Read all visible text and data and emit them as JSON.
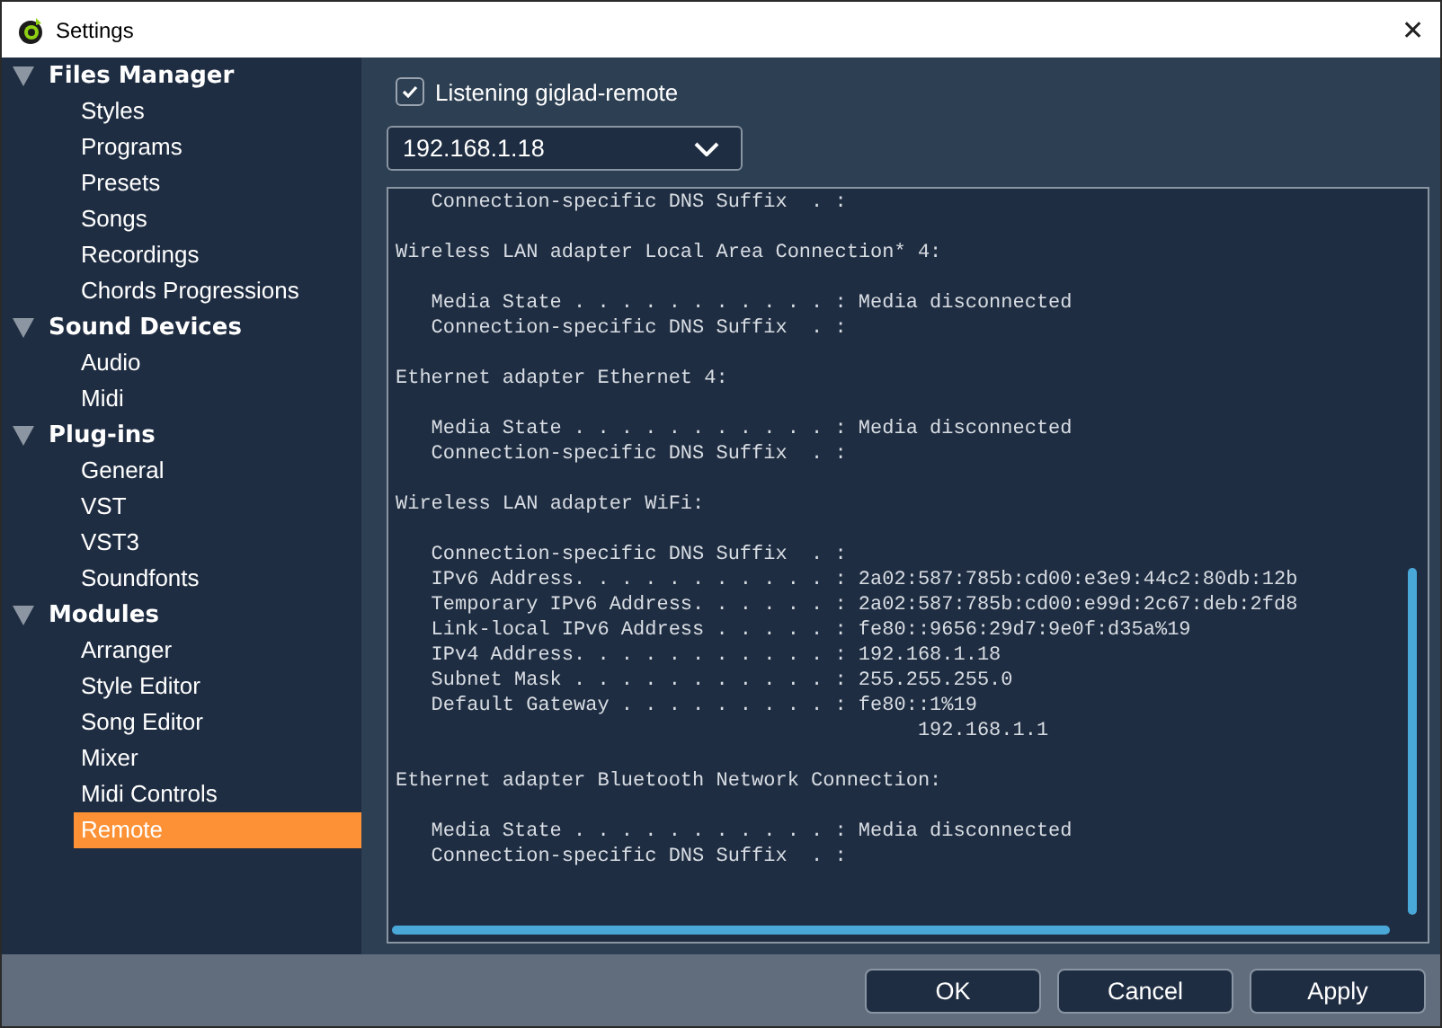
{
  "window": {
    "title": "Settings",
    "close": "✕"
  },
  "sidebar": {
    "groups": [
      {
        "label": "Files Manager",
        "expanded": true,
        "selected": false,
        "children": [
          {
            "label": "Styles",
            "selected": false
          },
          {
            "label": "Programs",
            "selected": false
          },
          {
            "label": "Presets",
            "selected": false
          },
          {
            "label": "Songs",
            "selected": false
          },
          {
            "label": "Recordings",
            "selected": false
          },
          {
            "label": "Chords Progressions",
            "selected": false
          }
        ]
      },
      {
        "label": "Sound Devices",
        "expanded": true,
        "selected": false,
        "children": [
          {
            "label": "Audio",
            "selected": false
          },
          {
            "label": "Midi",
            "selected": false
          }
        ]
      },
      {
        "label": "Plug-ins",
        "expanded": true,
        "selected": false,
        "children": [
          {
            "label": "General",
            "selected": false
          },
          {
            "label": "VST",
            "selected": false
          },
          {
            "label": "VST3",
            "selected": false
          },
          {
            "label": "Soundfonts",
            "selected": false
          }
        ]
      },
      {
        "label": "Modules",
        "expanded": true,
        "selected": false,
        "children": [
          {
            "label": "Arranger",
            "selected": false
          },
          {
            "label": "Style Editor",
            "selected": false
          },
          {
            "label": "Song Editor",
            "selected": false
          },
          {
            "label": "Mixer",
            "selected": false
          },
          {
            "label": "Midi Controls",
            "selected": false
          },
          {
            "label": "Remote",
            "selected": true
          }
        ]
      }
    ]
  },
  "listening": {
    "label": "Listening giglad-remote",
    "checked": true
  },
  "address_dropdown": {
    "value": "192.168.1.18"
  },
  "console": {
    "sections": [
      {
        "entries": [
          {
            "kind": "entry",
            "text": "Connection-specific DNS Suffix  . :"
          }
        ]
      },
      {
        "heading": "Wireless LAN adapter Local Area Connection* 4:",
        "entries": [
          {
            "kind": "entry",
            "text": "Media State . . . . . . . . . . . : Media disconnected"
          },
          {
            "kind": "entry",
            "text": "Connection-specific DNS Suffix  . :"
          }
        ]
      },
      {
        "heading": "Ethernet adapter Ethernet 4:",
        "entries": [
          {
            "kind": "entry",
            "text": "Media State . . . . . . . . . . . : Media disconnected"
          },
          {
            "kind": "entry",
            "text": "Connection-specific DNS Suffix  . :"
          }
        ]
      },
      {
        "heading": "Wireless LAN adapter WiFi:",
        "entries": [
          {
            "kind": "entry",
            "text": "Connection-specific DNS Suffix  . :"
          },
          {
            "kind": "entry",
            "text": "IPv6 Address. . . . . . . . . . . : 2a02:587:785b:cd00:e3e9:44c2:80db:12b"
          },
          {
            "kind": "entry",
            "text": "Temporary IPv6 Address. . . . . . : 2a02:587:785b:cd00:e99d:2c67:deb:2fd8"
          },
          {
            "kind": "entry",
            "text": "Link-local IPv6 Address . . . . . : fe80::9656:29d7:9e0f:d35a%19"
          },
          {
            "kind": "entry",
            "text": "IPv4 Address. . . . . . . . . . . : 192.168.1.18"
          },
          {
            "kind": "entry",
            "text": "Subnet Mask . . . . . . . . . . . : 255.255.255.0"
          },
          {
            "kind": "entry",
            "text": "Default Gateway . . . . . . . . . : fe80::1%19"
          },
          {
            "kind": "continuation",
            "text": "192.168.1.1"
          }
        ]
      },
      {
        "heading": "Ethernet adapter Bluetooth Network Connection:",
        "entries": [
          {
            "kind": "entry",
            "text": "Media State . . . . . . . . . . . : Media disconnected"
          },
          {
            "kind": "entry",
            "text": "Connection-specific DNS Suffix  . :"
          }
        ]
      }
    ]
  },
  "buttons": [
    "OK",
    "Cancel",
    "Apply"
  ]
}
